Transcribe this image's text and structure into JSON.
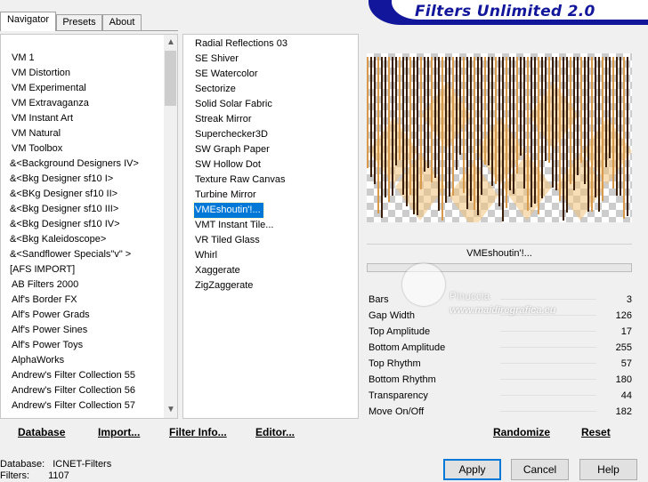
{
  "tabs": [
    "Navigator",
    "Presets",
    "About"
  ],
  "active_tab": "Navigator",
  "banner_title": "Filters Unlimited 2.0",
  "categories": [
    "VM 1",
    "VM Distortion",
    "VM Experimental",
    "VM Extravaganza",
    "VM Instant Art",
    "VM Natural",
    "VM Toolbox",
    "&<Background Designers IV>",
    "&<Bkg Designer sf10 I>",
    "&<BKg Designer sf10 II>",
    "&<Bkg Designer sf10 III>",
    "&<Bkg Designer sf10 IV>",
    "&<Bkg Kaleidoscope>",
    "&<Sandflower Specials\"v\" >",
    "[AFS IMPORT]",
    "AB Filters 2000",
    "Alf's Border FX",
    "Alf's Power Grads",
    "Alf's Power Sines",
    "Alf's Power Toys",
    "AlphaWorks",
    "Andrew's Filter Collection 55",
    "Andrew's Filter Collection 56",
    "Andrew's Filter Collection 57"
  ],
  "filters": [
    "Radial Reflections 03",
    "SE Shiver",
    "SE Watercolor",
    "Sectorize",
    "Solid Solar Fabric",
    "Streak Mirror",
    "Superchecker3D",
    "SW Graph Paper",
    "SW Hollow Dot",
    "Texture Raw Canvas",
    "Turbine Mirror",
    "VMEshoutin'!...",
    "VMT Instant Tile...",
    "VR Tiled Glass",
    "Whirl",
    "Xaggerate",
    "ZigZaggerate"
  ],
  "selected_filter": "VMEshoutin'!...",
  "filter_name_label": "VMEshoutin'!...",
  "params": [
    {
      "label": "Bars",
      "value": "3"
    },
    {
      "label": "Gap Width",
      "value": "126"
    },
    {
      "label": "Top Amplitude",
      "value": "17"
    },
    {
      "label": "Bottom Amplitude",
      "value": "255"
    },
    {
      "label": "Top Rhythm",
      "value": "57"
    },
    {
      "label": "Bottom Rhythm",
      "value": "180"
    },
    {
      "label": "Transparency",
      "value": "44"
    },
    {
      "label": "Move On/Off",
      "value": "182"
    }
  ],
  "bottom_links": {
    "database": "Database",
    "import": "Import...",
    "filter_info": "Filter Info...",
    "editor": "Editor...",
    "randomize": "Randomize",
    "reset": "Reset"
  },
  "buttons": {
    "apply": "Apply",
    "cancel": "Cancel",
    "help": "Help"
  },
  "status": {
    "database_label": "Database:",
    "database_value": "ICNET-Filters",
    "filters_label": "Filters:",
    "filters_value": "1107"
  },
  "watermark": {
    "name": "Pinuccia",
    "site": "www.maidiregrafica.eu"
  },
  "colors": {
    "banner": "#12169a",
    "selection": "#0078d7",
    "stripe_dark": "#3a1e08",
    "stripe_light": "#f2c27c"
  }
}
